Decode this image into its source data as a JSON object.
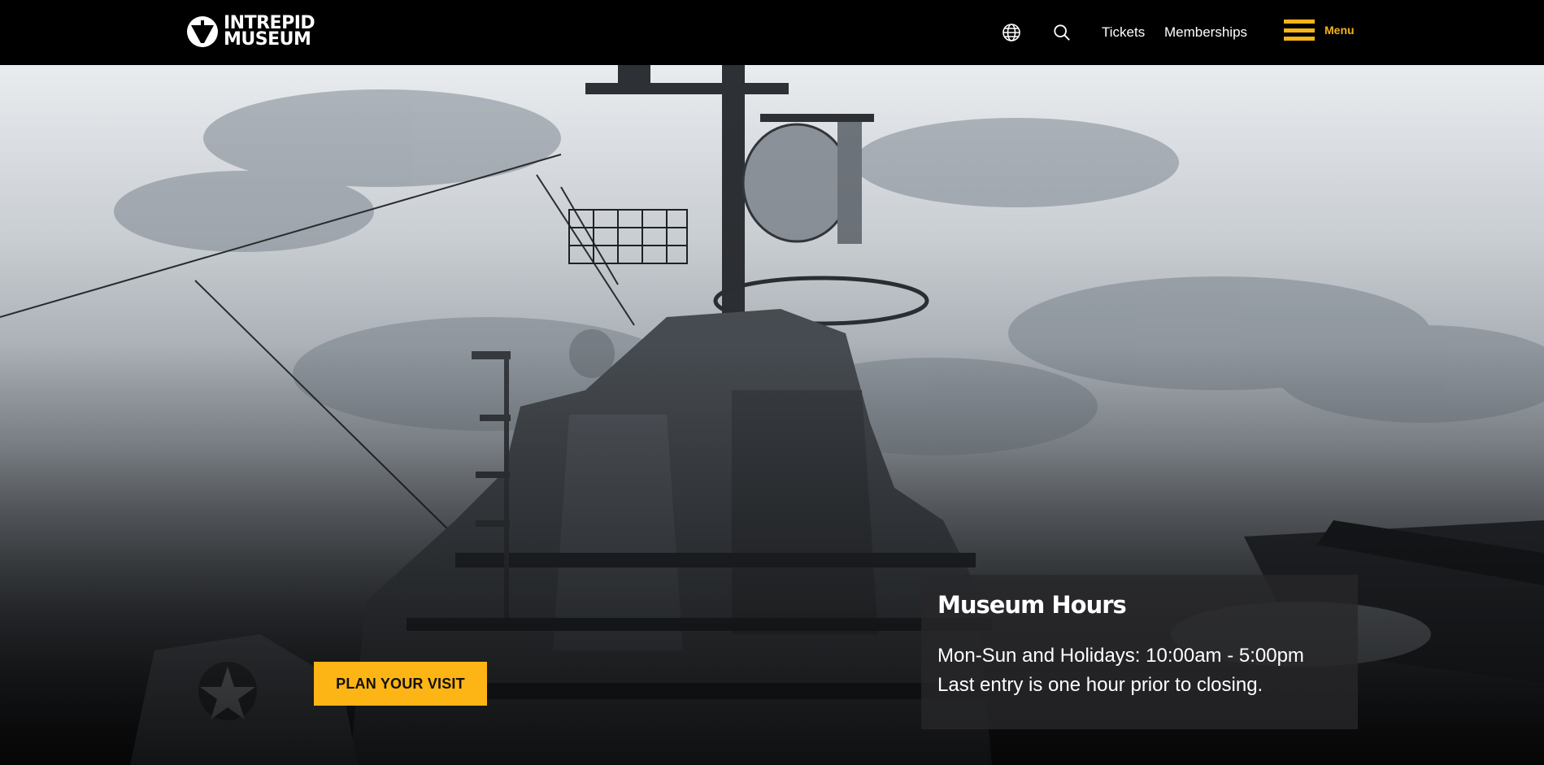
{
  "header": {
    "logo": {
      "line1": "INTREPID",
      "line2": "MUSEUM"
    },
    "icons": {
      "language": "globe-icon",
      "search": "search-icon"
    },
    "links": [
      {
        "label": "Tickets"
      },
      {
        "label": "Memberships"
      }
    ],
    "menu_label": "Menu"
  },
  "hero": {
    "cta_label": "PLAN YOUR VISIT",
    "hours": {
      "title": "Museum Hours",
      "line1": "Mon-Sun and Holidays: 10:00am - 5:00pm",
      "line2": "Last entry is one hour prior to closing."
    }
  },
  "colors": {
    "accent": "#fdb515",
    "header_bg": "#000000"
  }
}
